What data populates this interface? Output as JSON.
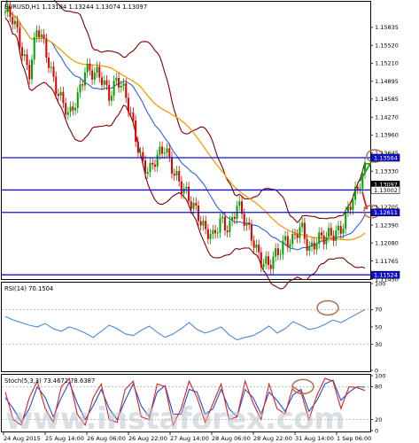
{
  "chart_data": [
    {
      "type": "candlestick",
      "panel": "price",
      "header": "EURUSD,H1  1.13184 1.13244 1.13074 1.13097",
      "y_ticks": [
        "1.15835",
        "1.15520",
        "1.15210",
        "1.14895",
        "1.14585",
        "1.14270",
        "1.13960",
        "1.13645",
        "1.13330",
        "1.13015",
        "1.12705",
        "1.12390",
        "1.12080",
        "1.11765",
        "1.11450"
      ],
      "ylim": [
        1.1145,
        1.1628
      ],
      "price_tags": [
        {
          "text": "1.13564",
          "value": 1.13564,
          "bg": "#1010d0",
          "fg": "#ffffff"
        },
        {
          "text": "1.13097",
          "value": 1.13097,
          "bg": "#000000",
          "fg": "#ffffff"
        },
        {
          "text": "1.13002",
          "value": 1.13002,
          "bg": "#ffffff",
          "fg": "#000000"
        },
        {
          "text": "1.12611",
          "value": 1.12611,
          "bg": "#1010d0",
          "fg": "#ffffff"
        },
        {
          "text": "1.11524",
          "value": 1.11524,
          "bg": "#1010d0",
          "fg": "#ffffff"
        }
      ],
      "levels": [
        1.13564,
        1.13002,
        1.12611,
        1.11524
      ],
      "price_path": [
        1.161,
        1.159,
        1.155,
        1.151,
        1.158,
        1.154,
        1.15,
        1.146,
        1.142,
        1.146,
        1.152,
        1.15,
        1.149,
        1.147,
        1.15,
        1.146,
        1.141,
        1.136,
        1.133,
        1.135,
        1.138,
        1.134,
        1.13,
        1.128,
        1.127,
        1.123,
        1.121,
        1.125,
        1.124,
        1.127,
        1.124,
        1.122,
        1.118,
        1.116,
        1.119,
        1.122,
        1.121,
        1.123,
        1.12,
        1.122,
        1.121,
        1.122,
        1.124,
        1.127,
        1.129,
        1.134
      ],
      "colors": {
        "up": "#00a000",
        "down": "#e00000",
        "level": "#1010d0",
        "ma_fast": "#3060e0",
        "ma_slow": "#f0a000",
        "bands": "#800000",
        "annot": "#b07050"
      }
    },
    {
      "type": "line",
      "panel": "rsi",
      "label": "RSI(14) 70.1504",
      "y_ticks": [
        "100",
        "70",
        "50",
        "30",
        "0"
      ],
      "ylim": [
        0,
        100
      ],
      "values": [
        62,
        58,
        55,
        52,
        50,
        54,
        48,
        45,
        50,
        47,
        43,
        38,
        45,
        52,
        48,
        42,
        40,
        46,
        51,
        44,
        38,
        42,
        48,
        55,
        47,
        43,
        46,
        50,
        41,
        35,
        38,
        40,
        45,
        51,
        43,
        48,
        56,
        52,
        47,
        49,
        53,
        58,
        55,
        60,
        65,
        70
      ],
      "color": "#4a8ad8"
    },
    {
      "type": "line",
      "panel": "stochastic",
      "label": "Stoch(5,3,3) 73.4672 78.6387",
      "y_ticks": [
        "100",
        "80",
        "20",
        "0"
      ],
      "ylim": [
        0,
        100
      ],
      "series": [
        {
          "values": [
            70,
            20,
            10,
            60,
            90,
            40,
            15,
            80,
            95,
            30,
            10,
            60,
            85,
            20,
            15,
            75,
            90,
            25,
            20,
            85,
            80,
            10,
            40,
            90,
            60,
            15,
            50,
            85,
            20,
            25,
            90,
            50,
            20,
            85,
            40,
            30,
            80,
            70,
            20,
            65,
            95,
            90,
            40,
            80,
            78,
            73
          ]
        },
        {
          "values": [
            60,
            40,
            15,
            40,
            80,
            60,
            25,
            60,
            88,
            50,
            20,
            45,
            75,
            40,
            20,
            55,
            85,
            45,
            25,
            70,
            82,
            30,
            30,
            75,
            70,
            30,
            40,
            75,
            40,
            25,
            75,
            60,
            30,
            70,
            55,
            35,
            65,
            75,
            35,
            55,
            85,
            92,
            55,
            70,
            80,
            79
          ]
        }
      ],
      "colors": {
        "main": "#e02020",
        "signal": "#2050d0"
      }
    }
  ],
  "x_ticks": [
    "24 Aug 2015",
    "25 Aug 14:00",
    "26 Aug 06:00",
    "26 Aug 22:00",
    "27 Aug 14:00",
    "28 Aug 06:00",
    "28 Aug 22:00",
    "31 Aug 14:00",
    "1 Sep 06:00"
  ],
  "watermark": "www.instaforex.com"
}
